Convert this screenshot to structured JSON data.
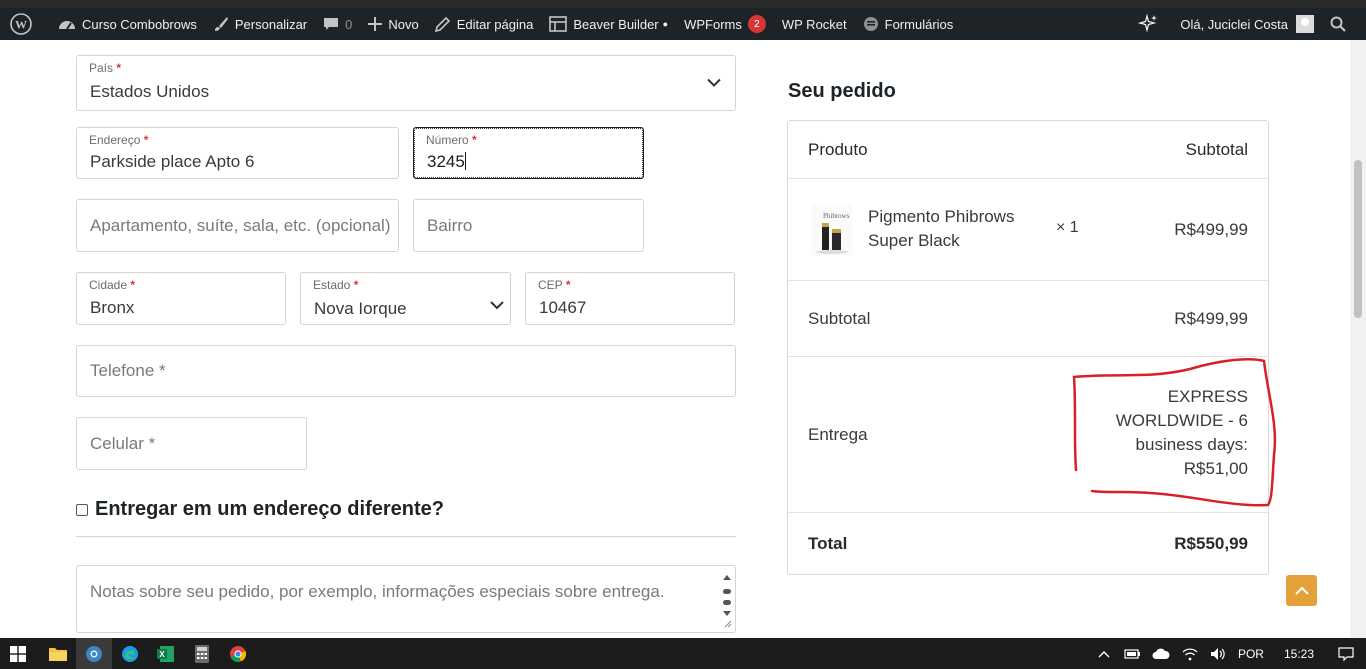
{
  "adminbar": {
    "site_name": "Curso Combobrows",
    "customize": "Personalizar",
    "comments_count": "0",
    "new": "Novo",
    "edit_page": "Editar página",
    "beaver_builder": "Beaver Builder",
    "wpforms": "WPForms",
    "wpforms_badge": "2",
    "wp_rocket": "WP Rocket",
    "forms": "Formulários",
    "greeting": "Olá, Juciclei Costa"
  },
  "form": {
    "country": {
      "label": "País",
      "req": "*",
      "value": "Estados Unidos"
    },
    "address": {
      "label": "Endereço",
      "req": "*",
      "value": "Parkside place Apto 6"
    },
    "number": {
      "label": "Número",
      "req": "*",
      "value": "3245"
    },
    "apartment": {
      "placeholder": "Apartamento, suíte, sala, etc. (opcional)"
    },
    "neighborhood": {
      "placeholder": "Bairro"
    },
    "city": {
      "label": "Cidade",
      "req": "*",
      "value": "Bronx"
    },
    "state": {
      "label": "Estado",
      "req": "*",
      "value": "Nova Iorque"
    },
    "zip": {
      "label": "CEP",
      "req": "*",
      "value": "10467"
    },
    "phone": {
      "placeholder": "Telefone *"
    },
    "mobile": {
      "placeholder": "Celular *"
    },
    "ship_different": "Entregar em um endereço diferente?",
    "notes": {
      "placeholder": "Notas sobre seu pedido, por exemplo, informações especiais sobre entrega."
    }
  },
  "order": {
    "title": "Seu pedido",
    "col_product": "Produto",
    "col_subtotal": "Subtotal",
    "product_line1": "Pigmento Phibrows",
    "product_line2": "Super Black",
    "product_qty": "× 1",
    "product_price": "R$499,99",
    "subtotal_label": "Subtotal",
    "subtotal_value": "R$499,99",
    "shipping_label": "Entrega",
    "shipping_lines": [
      "EXPRESS",
      "WORLDWIDE - 6",
      "business days:",
      "R$51,00"
    ],
    "total_label": "Total",
    "total_value": "R$550,99"
  },
  "taskbar": {
    "language": "POR",
    "time": "15:23"
  },
  "colors": {
    "accent_orange": "#e4a13a",
    "required_red": "#d63638",
    "annotation_red": "#d8202a",
    "adminbar_bg": "#1d2327"
  }
}
